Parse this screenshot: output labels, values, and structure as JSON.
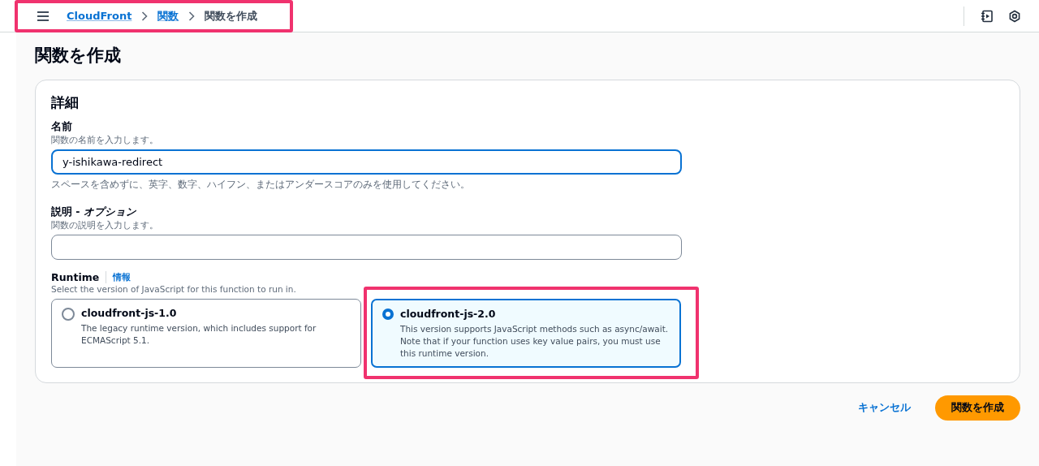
{
  "top_bar": {
    "breadcrumb": {
      "highlighted": true,
      "items": [
        {
          "label": "CloudFront",
          "link": true
        },
        {
          "label": "関数",
          "link": true
        },
        {
          "label": "関数を作成",
          "link": false
        }
      ]
    }
  },
  "page_title": "関数を作成",
  "details": {
    "title": "詳細",
    "name_field": {
      "label": "名前",
      "description": "関数の名前を入力します。",
      "value": "y-ishikawa-redirect",
      "focused": true,
      "constraint": "スペースを含めずに、英字、数字、ハイフン、またはアンダースコアのみを使用してください。"
    },
    "description_field": {
      "label": "説明 - *オプション*",
      "description": "関数の説明を入力します。",
      "focused": false
    },
    "runtime": {
      "label": "Runtime",
      "info_link": "情報",
      "description": "Select the version of JavaScript for this function to run in.",
      "options": [
        {
          "title": "cloudfront-js-1.0",
          "description": "The legacy runtime version, which includes support for ECMAScript 5.1.",
          "selected": false,
          "highlighted": false
        },
        {
          "title": "cloudfront-js-2.0",
          "description": "This version supports JavaScript methods such as async/await. Note that if your function uses key value pairs, you must use this runtime version.",
          "selected": true,
          "highlighted": true
        }
      ]
    }
  },
  "actions": {
    "cancel": "キャンセル",
    "submit": "関数を作成"
  }
}
